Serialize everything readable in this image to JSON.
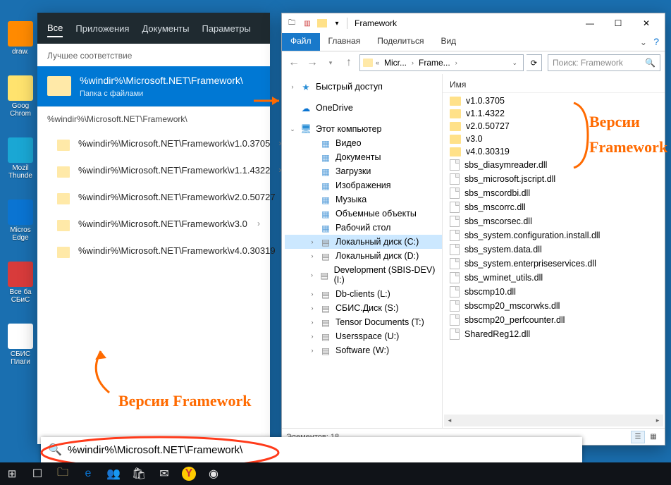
{
  "desktop": {
    "icons": [
      "draw.",
      "Goog\nChrom",
      "Mozil\nThunde",
      "Micros\nEdge",
      "Все ба\nСБиС",
      "СБИС\nПлаги"
    ]
  },
  "start": {
    "tabs": {
      "all": "Все",
      "apps": "Приложения",
      "docs": "Документы",
      "settings": "Параметры"
    },
    "best_header": "Лучшее соответствие",
    "match": {
      "title": "%windir%\\Microsoft.NET\\Framework\\",
      "sub": "Папка с файлами"
    },
    "group_header": "%windir%\\Microsoft.NET\\Framework\\",
    "results": [
      "%windir%\\Microsoft.NET\\Framework\\v1.0.3705",
      "%windir%\\Microsoft.NET\\Framework\\v1.1.4322",
      "%windir%\\Microsoft.NET\\Framework\\v2.0.50727",
      "%windir%\\Microsoft.NET\\Framework\\v3.0",
      "%windir%\\Microsoft.NET\\Framework\\v4.0.30319"
    ]
  },
  "search": {
    "value": "%windir%\\Microsoft.NET\\Framework\\"
  },
  "explorer": {
    "title": "Framework",
    "ribbon": {
      "file": "Файл",
      "home": "Главная",
      "share": "Поделиться",
      "view": "Вид"
    },
    "crumbs": [
      "Micr...",
      "Frame..."
    ],
    "search_ph": "Поиск: Framework",
    "tree": {
      "quick": "Быстрый доступ",
      "onedrive": "OneDrive",
      "thispc": "Этот компьютер",
      "children": [
        "Видео",
        "Документы",
        "Загрузки",
        "Изображения",
        "Музыка",
        "Объемные объекты",
        "Рабочий стол",
        "Локальный диск (C:)",
        "Локальный диск (D:)",
        "Development (SBIS-DEV) (I:)",
        "Db-clients (L:)",
        "СБИС.Диск (S:)",
        "Tensor Documents (T:)",
        "Usersspace (U:)",
        "Software (W:)"
      ]
    },
    "col_name": "Имя",
    "folders": [
      "v1.0.3705",
      "v1.1.4322",
      "v2.0.50727",
      "v3.0",
      "v4.0.30319"
    ],
    "files": [
      "sbs_diasymreader.dll",
      "sbs_microsoft.jscript.dll",
      "sbs_mscordbi.dll",
      "sbs_mscorrc.dll",
      "sbs_mscorsec.dll",
      "sbs_system.configuration.install.dll",
      "sbs_system.data.dll",
      "sbs_system.enterpriseservices.dll",
      "sbs_wminet_utils.dll",
      "sbscmp10.dll",
      "sbscmp20_mscorwks.dll",
      "sbscmp20_perfcounter.dll",
      "SharedReg12.dll"
    ],
    "status": "Элементов: 18"
  },
  "annotations": {
    "left": "Версии Framework",
    "right1": "Версии",
    "right2": "Framework"
  }
}
